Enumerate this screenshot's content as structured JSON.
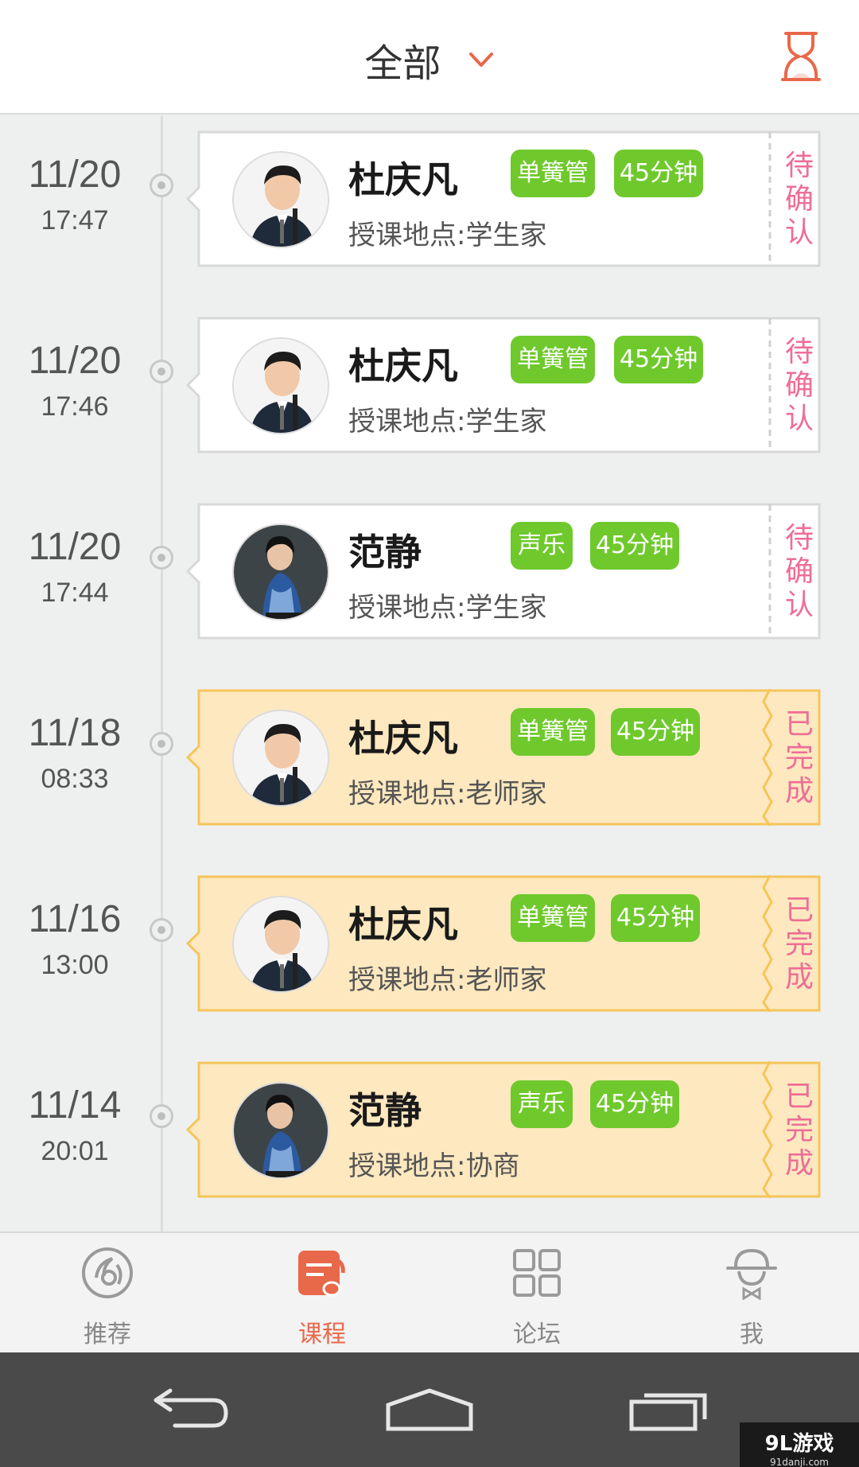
{
  "header": {
    "title": "全部",
    "dropdown_icon": "chevron-down-icon",
    "right_icon": "hourglass-icon",
    "accent": "#e8684a"
  },
  "lessons": [
    {
      "date": "11/20",
      "time": "17:47",
      "teacher": "杜庆凡",
      "instrument": "单簧管",
      "duration": "45分钟",
      "location": "授课地点:学生家",
      "status": [
        "待",
        "确",
        "认"
      ],
      "state": "pending",
      "avatar": "male"
    },
    {
      "date": "11/20",
      "time": "17:46",
      "teacher": "杜庆凡",
      "instrument": "单簧管",
      "duration": "45分钟",
      "location": "授课地点:学生家",
      "status": [
        "待",
        "确",
        "认"
      ],
      "state": "pending",
      "avatar": "male"
    },
    {
      "date": "11/20",
      "time": "17:44",
      "teacher": "范静",
      "instrument": "声乐",
      "duration": "45分钟",
      "location": "授课地点:学生家",
      "status": [
        "待",
        "确",
        "认"
      ],
      "state": "pending",
      "avatar": "female"
    },
    {
      "date": "11/18",
      "time": "08:33",
      "teacher": "杜庆凡",
      "instrument": "单簧管",
      "duration": "45分钟",
      "location": "授课地点:老师家",
      "status": [
        "已",
        "完",
        "成"
      ],
      "state": "done",
      "avatar": "male"
    },
    {
      "date": "11/16",
      "time": "13:00",
      "teacher": "杜庆凡",
      "instrument": "单簧管",
      "duration": "45分钟",
      "location": "授课地点:老师家",
      "status": [
        "已",
        "完",
        "成"
      ],
      "state": "done",
      "avatar": "male"
    },
    {
      "date": "11/14",
      "time": "20:01",
      "teacher": "范静",
      "instrument": "声乐",
      "duration": "45分钟",
      "location": "授课地点:协商",
      "status": [
        "已",
        "完",
        "成"
      ],
      "state": "done",
      "avatar": "female"
    }
  ],
  "nav": [
    {
      "label": "推荐",
      "icon": "recommend-icon",
      "active": false
    },
    {
      "label": "课程",
      "icon": "course-icon",
      "active": true
    },
    {
      "label": "论坛",
      "icon": "forum-icon",
      "active": false
    },
    {
      "label": "我",
      "icon": "profile-icon",
      "active": false
    }
  ],
  "system_bar": {
    "back_icon": "back-icon",
    "home_icon": "home-icon",
    "recents_icon": "recents-icon"
  },
  "watermark": {
    "brand": "9L游戏",
    "site": "91danji.com"
  },
  "colors": {
    "tag_green": "#6fc92c",
    "status_pink": "#ee6d96",
    "done_card_bg": "#fde8bf",
    "done_card_border": "#f5c55a",
    "pending_card_bg": "#ffffff"
  }
}
